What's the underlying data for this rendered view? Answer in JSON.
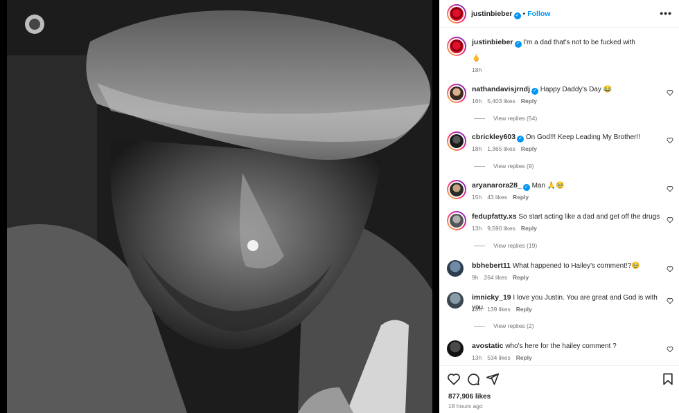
{
  "post": {
    "author": "justinbieber",
    "follow_label": "Follow",
    "dot": "•",
    "more_label": "•••",
    "caption_user": "justinbieber",
    "caption_text": "I'm a dad that's not to be fucked with",
    "caption_emoji": "🖕",
    "caption_time": "18h"
  },
  "comments": [
    {
      "user": "nathandavisjrndj",
      "verified": true,
      "text": "Happy Daddy's Day 😂",
      "time": "16h",
      "likes": "5,403 likes",
      "reply": "Reply",
      "view_replies": "View replies (54)"
    },
    {
      "user": "cbrickley603",
      "verified": true,
      "text": "On God!!! Keep Leading My Brother!!",
      "time": "18h",
      "likes": "1,365 likes",
      "reply": "Reply",
      "view_replies": "View replies (9)"
    },
    {
      "user": "aryanarora28_",
      "verified": true,
      "text": "Man 🙏🥹",
      "time": "15h",
      "likes": "43 likes",
      "reply": "Reply",
      "view_replies": ""
    },
    {
      "user": "fedupfatty.xs",
      "verified": false,
      "text": "So start acting like a dad and get off the drugs",
      "time": "13h",
      "likes": "9,590 likes",
      "reply": "Reply",
      "view_replies": "View replies (19)"
    },
    {
      "user": "bbhebert11",
      "verified": false,
      "text": "What happened to Hailey's comment!?🥹",
      "time": "9h",
      "likes": "264 likes",
      "reply": "Reply",
      "view_replies": ""
    },
    {
      "user": "imnicky_19",
      "verified": false,
      "text": "I love you Justin. You are great and God is with you.",
      "time": "18h",
      "likes": "139 likes",
      "reply": "Reply",
      "view_replies": "View replies (2)"
    },
    {
      "user": "avostatic",
      "verified": false,
      "text": "who's here for the hailey comment ?",
      "time": "13h",
      "likes": "534 likes",
      "reply": "Reply",
      "view_replies": ""
    }
  ],
  "footer": {
    "likes": "877,906 likes",
    "time_ago": "18 hours ago"
  },
  "icons": {
    "like": "heart-icon",
    "comment": "comment-icon",
    "share": "share-icon",
    "save": "bookmark-icon"
  },
  "colors": {
    "link": "#0095f6",
    "verified": "#0095f6",
    "muted": "#737373"
  }
}
